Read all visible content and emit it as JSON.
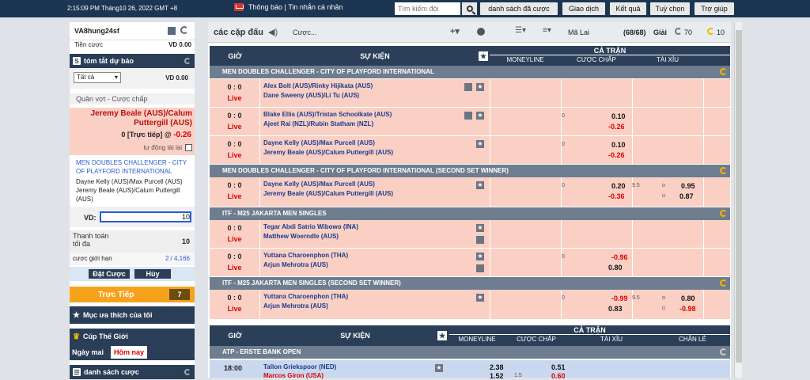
{
  "topbar": {
    "clock": "2:15:09 PM Tháng10 26, 2022 GMT +8",
    "notify": "Thông báo | Tin nhắn cá nhân",
    "search_placeholder": "Tìm kiếm đội",
    "nav": [
      "danh sách đã cược",
      "Giao dịch",
      "Kết quả",
      "Tuỳ chọn",
      "Trợ giúp"
    ]
  },
  "account": {
    "user": "VA8hung24sf",
    "balance_label": "Tiền cược",
    "balance": "VD  0.00"
  },
  "slip": {
    "title": "tóm tắt dự báo",
    "filter": "Tất cả",
    "amount": "VD 0.00",
    "sport": "Quần vợt - Cược chấp",
    "pick": "Jeremy Beale (AUS)/Calum Puttergill (AUS)",
    "odds_prefix": "0 [Trực tiếp] @",
    "odds": "-0.26",
    "auto": "tự động tài lại",
    "league": "MEN DOUBLES CHALLENGER - CITY OF PLAYFORD INTERNATIONAL",
    "team1": "Dayne Kelly (AUS)/Max Purcell (AUS)",
    "team2": "Jeremy Beale (AUS)/Calum Puttergill (AUS)",
    "vd_label": "VD:",
    "vd_value": "10",
    "max_pay_label": "Thanh toán tối đa",
    "max_pay": "10",
    "limit_label": "cược giới hạn",
    "limit": "2 / 4,166",
    "place": "Đặt Cược",
    "cancel": "Hủy"
  },
  "live": {
    "label": "Trực Tiếp",
    "count": "7"
  },
  "fav": "Mục ưa thích của tôi",
  "cup": {
    "title": "Cúp Thế Giới",
    "tab1": "Ngày mai",
    "tab2": "Hôm nay"
  },
  "betlist": "danh sách cược",
  "controls": {
    "title": "các cặp đấu",
    "sound": "Cược...",
    "odds_type": "Mã Lai",
    "count": "(68/68)",
    "count_label": "Giải",
    "refresh1": "70",
    "refresh2": "10"
  },
  "header": {
    "time": "GIỜ",
    "event": "SỰ KIỆN",
    "full": "CẢ TRẬN",
    "moneyline": "MONEYLINE",
    "handicap": "CƯỢC CHẤP",
    "ou": "TÀI XỈU",
    "oe": "CHẴN LẺ"
  },
  "leagues": [
    "MEN DOUBLES CHALLENGER - CITY OF PLAYFORD INTERNATIONAL",
    "MEN DOUBLES CHALLENGER - CITY OF PLAYFORD INTERNATIONAL (SECOND SET WINNER)",
    "ITF - M25 JAKARTA MEN SINGLES",
    "ITF - M25 JAKARTA MEN SINGLES (SECOND SET WINNER)",
    "ATP - ERSTE BANK OPEN"
  ],
  "matches": [
    {
      "score": "0 : 0",
      "status": "Live",
      "home": "Alex Bolt (AUS)/Rinky Hijikata (AUS)",
      "away": "Dane Sweeny (AUS)/Li Tu (AUS)",
      "hdp_line": "",
      "hdp1": "",
      "hdp2": ""
    },
    {
      "score": "0 : 0",
      "status": "Live",
      "home": "Blake Ellis (AUS)/Tristan Schoolkate (AUS)",
      "away": "Ajeet Rai (NZL)/Rubin Statham (NZL)",
      "hdp_line": "0",
      "hdp1": "0.10",
      "hdp2": "-0.26"
    },
    {
      "score": "0 : 0",
      "status": "Live",
      "home": "Dayne Kelly (AUS)/Max Purcell (AUS)",
      "away": "Jeremy Beale (AUS)/Calum Puttergill (AUS)",
      "hdp_line": "0",
      "hdp1": "0.10",
      "hdp2": "-0.26"
    },
    {
      "score": "0 : 0",
      "status": "Live",
      "home": "Dayne Kelly (AUS)/Max Purcell (AUS)",
      "away": "Jeremy Beale (AUS)/Calum Puttergill (AUS)",
      "hdp_line": "0",
      "hdp1": "0.20",
      "hdp2": "-0.36",
      "ou_line": "9.5",
      "ou_o": "o",
      "ou_u": "u",
      "ou1": "0.95",
      "ou2": "0.87"
    },
    {
      "score": "0 : 0",
      "status": "Live",
      "home": "Tegar Abdi Satrio Wibowo (INA)",
      "away": "Matthew Woerndle (AUS)",
      "hdp_line": "",
      "hdp1": "",
      "hdp2": ""
    },
    {
      "score": "0 : 0",
      "status": "Live",
      "home": "Yuttana Charoenphon (THA)",
      "away": "Arjun Mehrotra (AUS)",
      "hdp_line": "0",
      "hdp1": "-0.96",
      "hdp2": "0.80"
    },
    {
      "score": "0 : 0",
      "status": "Live",
      "home": "Yuttana Charoenphon (THA)",
      "away": "Arjun Mehrotra (AUS)",
      "hdp_line": "0",
      "hdp1": "-0.99",
      "hdp2": "0.83",
      "ou_line": "9.5",
      "ou_o": "o",
      "ou_u": "u",
      "ou1": "0.80",
      "ou2": "-0.98"
    }
  ],
  "atp": {
    "time": "18:00",
    "home": "Tallon Griekspoor (NED)",
    "away": "Marcos Giron (USA)",
    "ml1": "2.38",
    "ml2": "1.52",
    "hdp_line": "1.5",
    "hdp1": "0.51",
    "hdp2": "0.60"
  },
  "colors": {
    "topbar": "#1c3553",
    "row": "#fad0c4",
    "header": "#2b3f58",
    "league": "#6e7d8f",
    "live_btn": "#f7a21b"
  }
}
